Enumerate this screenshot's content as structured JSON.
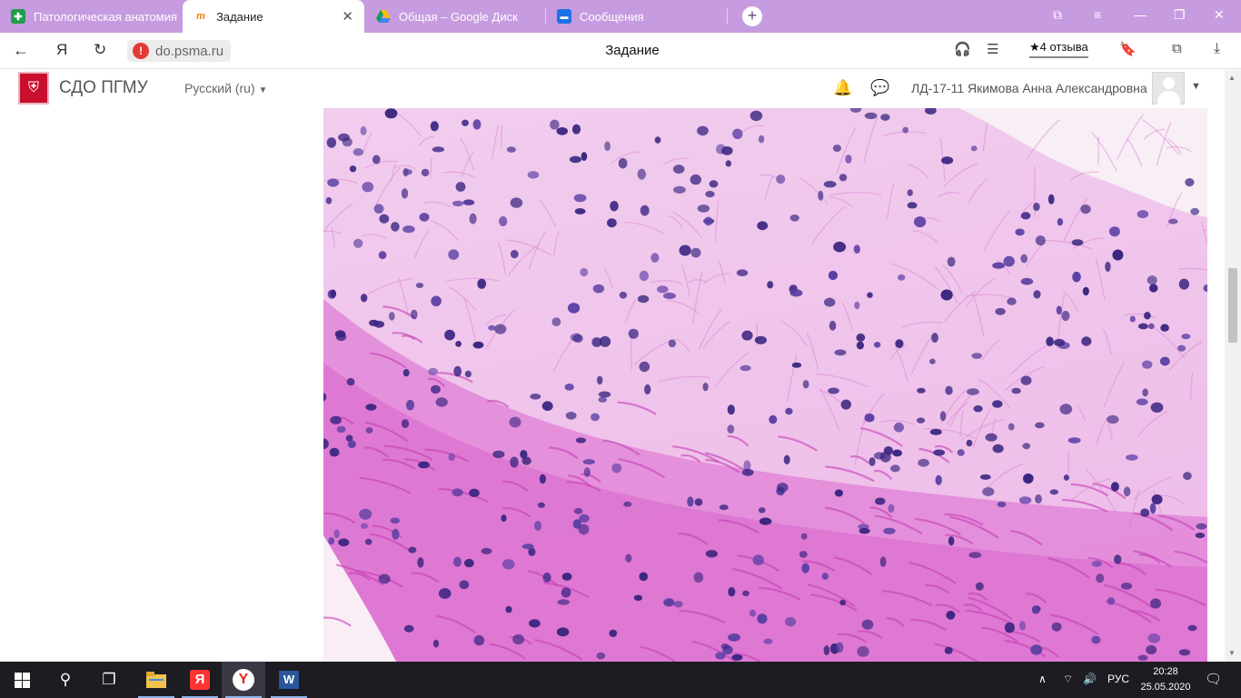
{
  "browser": {
    "tabs": [
      {
        "title": "Патологическая анатомия",
        "active": false
      },
      {
        "title": "Задание",
        "active": true
      },
      {
        "title": "Общая – Google Диск",
        "active": false
      },
      {
        "title": "Сообщения",
        "active": false
      }
    ],
    "address": {
      "yandex_glyph": "Я",
      "domain": "do.psma.ru",
      "page_title": "Задание",
      "reviews": "4 отзыва",
      "star_glyph": "★"
    }
  },
  "moodle": {
    "site_name": "СДО ПГМУ",
    "language": "Русский (ru)",
    "user_name": "ЛД-17-11 Якимова Анна Александровна"
  },
  "taskbar": {
    "language": "РУС",
    "time": "20:28",
    "date": "25.05.2020"
  },
  "colors": {
    "tabstrip": "#c79be0",
    "logo_red": "#c8102e",
    "tissue_background": "#f2c9ee",
    "tissue_pink": "#d955c9",
    "nucleus": "#3a2580"
  }
}
